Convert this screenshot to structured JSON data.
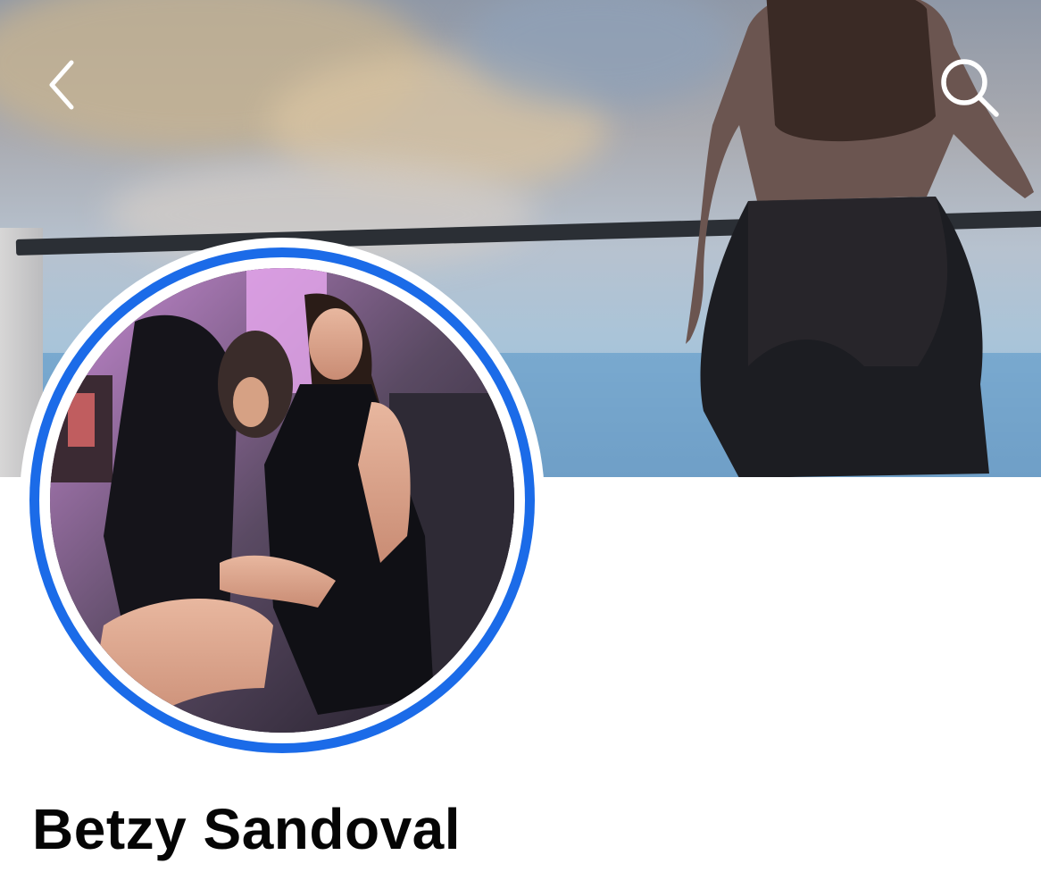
{
  "profile": {
    "name": "Betzy Sandoval"
  },
  "header": {
    "back_icon": "chevron-left-icon",
    "search_icon": "search-icon"
  },
  "colors": {
    "story_ring": "#1b6be8",
    "name_text": "#050505",
    "background": "#ffffff"
  }
}
